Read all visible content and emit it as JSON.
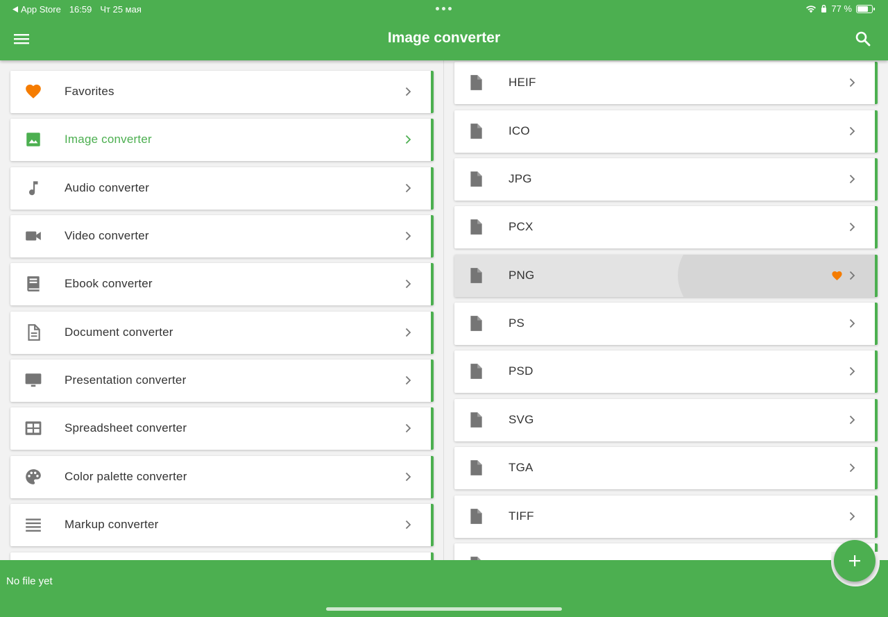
{
  "status_bar": {
    "back_app": "App Store",
    "time": "16:59",
    "date": "Чт 25 мая",
    "battery": "77 %"
  },
  "app_bar": {
    "title": "Image converter",
    "menu_icon": "menu-icon",
    "search_icon": "search-icon"
  },
  "categories": [
    {
      "label": "Favorites",
      "icon": "heart-icon",
      "icon_color": "#f57c00"
    },
    {
      "label": "Image converter",
      "icon": "image-icon",
      "icon_color": "#4caf50",
      "active": true
    },
    {
      "label": "Audio converter",
      "icon": "music-note-icon"
    },
    {
      "label": "Video converter",
      "icon": "video-camera-icon"
    },
    {
      "label": "Ebook converter",
      "icon": "book-icon"
    },
    {
      "label": "Document converter",
      "icon": "document-icon"
    },
    {
      "label": "Presentation converter",
      "icon": "monitor-icon"
    },
    {
      "label": "Spreadsheet converter",
      "icon": "table-icon"
    },
    {
      "label": "Color palette converter",
      "icon": "palette-icon"
    },
    {
      "label": "Markup converter",
      "icon": "lines-icon"
    }
  ],
  "formats": [
    {
      "label": "HEIF"
    },
    {
      "label": "ICO"
    },
    {
      "label": "JPG"
    },
    {
      "label": "PCX"
    },
    {
      "label": "PNG",
      "favorite": true,
      "highlighted": true
    },
    {
      "label": "PS"
    },
    {
      "label": "PSD"
    },
    {
      "label": "SVG"
    },
    {
      "label": "TGA"
    },
    {
      "label": "TIFF"
    }
  ],
  "bottom": {
    "file_status": "No file yet"
  },
  "colors": {
    "accent": "#4caf50",
    "favorite": "#f57c00",
    "icon_gray": "#757575"
  }
}
